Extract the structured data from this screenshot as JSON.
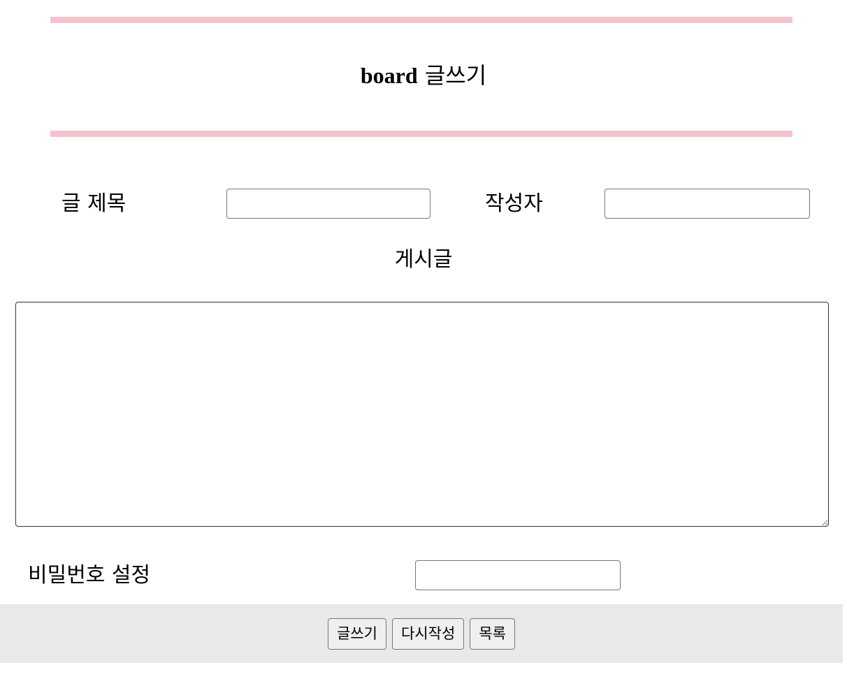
{
  "header": {
    "title_en": "board",
    "title_ko": "글쓰기",
    "rule_color": "#f4c3cd"
  },
  "form": {
    "title_label": "글 제목",
    "title_value": "",
    "writer_label": "작성자",
    "writer_value": "",
    "content_label": "게시글",
    "content_value": "",
    "password_label": "비밀번호 설정",
    "password_value": ""
  },
  "footer": {
    "background": "#e9e9e9",
    "write_button": "글쓰기",
    "reset_button": "다시작성",
    "list_button": "목록"
  }
}
